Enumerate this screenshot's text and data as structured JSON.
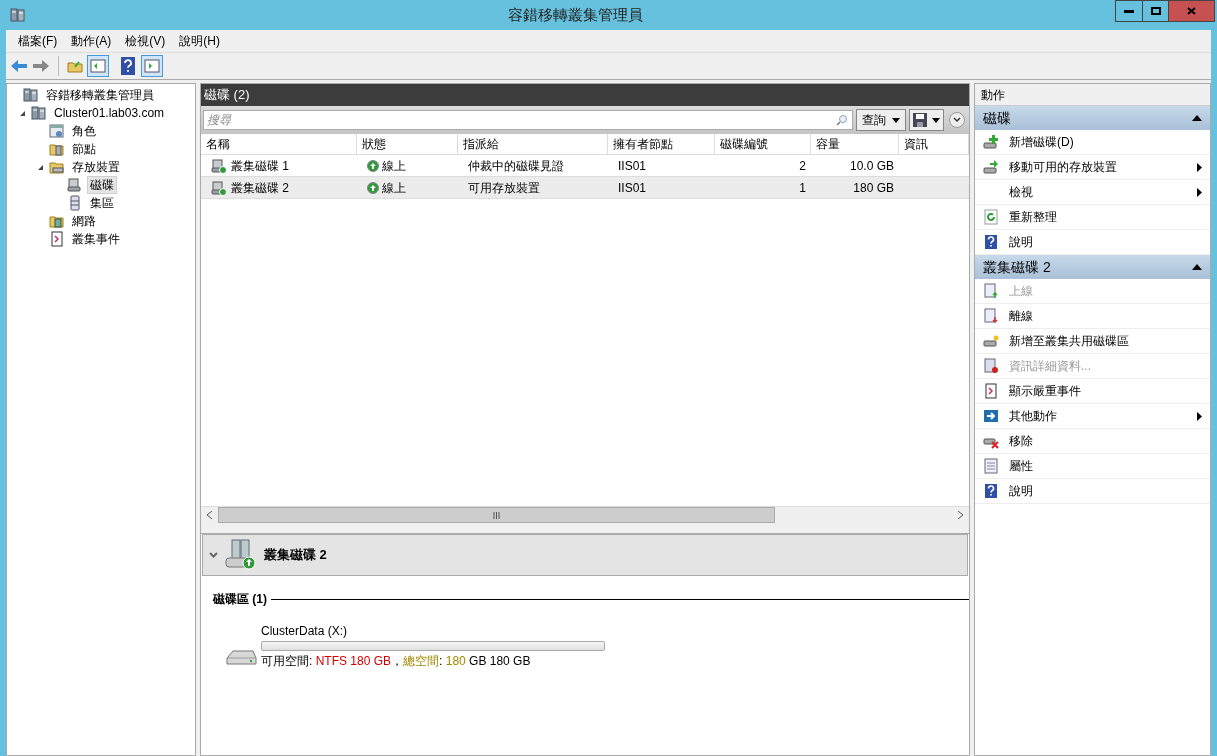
{
  "window": {
    "title": "容錯移轉叢集管理員"
  },
  "menu": [
    "檔案(F)",
    "動作(A)",
    "檢視(V)",
    "說明(H)"
  ],
  "tree": [
    {
      "label": "容錯移轉叢集管理員",
      "kind": "cluster",
      "selected": false,
      "children": [
        {
          "label": "Cluster01.lab03.com",
          "kind": "cluster",
          "selected": false,
          "expanded": true,
          "children": [
            {
              "label": "角色",
              "kind": "roles",
              "selected": false
            },
            {
              "label": "節點",
              "kind": "nodes",
              "selected": false
            },
            {
              "label": "存放裝置",
              "kind": "storage",
              "selected": false,
              "expanded": true,
              "children": [
                {
                  "label": "磁碟",
                  "kind": "disk",
                  "selected": true
                },
                {
                  "label": "集區",
                  "kind": "pool",
                  "selected": false
                }
              ]
            },
            {
              "label": "網路",
              "kind": "network",
              "selected": false
            },
            {
              "label": "叢集事件",
              "kind": "events",
              "selected": false
            }
          ]
        }
      ]
    }
  ],
  "center": {
    "title": "磁碟 (2)",
    "search": {
      "placeholder": "搜尋"
    },
    "query_button": "查詢",
    "table": {
      "columns": [
        "名稱",
        "狀態",
        "指派給",
        "擁有者節點",
        "磁碟編號",
        "容量",
        "資訊"
      ],
      "rows": [
        {
          "name": "叢集磁碟 1",
          "status": "線上",
          "assigned_to": "仲裁中的磁碟見證",
          "owner_node": "IIS01",
          "disk_number": "2",
          "capacity": "10.0 GB",
          "selected": false
        },
        {
          "name": "叢集磁碟 2",
          "status": "線上",
          "assigned_to": "可用存放裝置",
          "owner_node": "IIS01",
          "disk_number": "1",
          "capacity": "180 GB",
          "selected": true
        }
      ]
    }
  },
  "details": {
    "title": "叢集磁碟 2",
    "expanded": true,
    "section": "磁碟區 (1)",
    "volume": {
      "name": "ClusterData (X:)",
      "info": [
        {
          "text": "可用空間: ",
          "kind": "plain"
        },
        {
          "text": "NTFS 180 GB",
          "kind": "red"
        },
        {
          "text": "，",
          "kind": "plain"
        },
        {
          "text": "總空間",
          "kind": "yellow"
        },
        {
          "text": ": ",
          "kind": "plain"
        },
        {
          "text": "180",
          "kind": "yellow"
        },
        {
          "text": " GB 180 GB",
          "kind": "plain"
        }
      ]
    }
  },
  "actions": {
    "title": "動作",
    "sections": [
      {
        "title": "磁碟",
        "expanded": true,
        "items": [
          {
            "label": "新增磁碟(D)",
            "kind": "add-disk",
            "disabled": false,
            "submenu": false
          },
          {
            "label": "移動可用的存放裝置",
            "kind": "move-storage",
            "disabled": false,
            "submenu": true
          },
          {
            "label": "檢視",
            "kind": "none",
            "disabled": false,
            "submenu": true
          },
          {
            "label": "重新整理",
            "kind": "refresh",
            "disabled": false,
            "submenu": false
          },
          {
            "label": "說明",
            "kind": "help",
            "disabled": false,
            "submenu": false
          }
        ]
      },
      {
        "title": "叢集磁碟 2",
        "expanded": true,
        "items": [
          {
            "label": "上線",
            "kind": "online",
            "disabled": true,
            "submenu": false
          },
          {
            "label": "離線",
            "kind": "offline",
            "disabled": false,
            "submenu": false
          },
          {
            "label": "新增至叢集共用磁碟區",
            "kind": "add-csv",
            "disabled": false,
            "submenu": false
          },
          {
            "label": "資訊詳細資料...",
            "kind": "info",
            "disabled": true,
            "submenu": false
          },
          {
            "label": "顯示嚴重事件",
            "kind": "events",
            "disabled": false,
            "submenu": false
          },
          {
            "label": "其他動作",
            "kind": "more",
            "disabled": false,
            "submenu": true
          },
          {
            "label": "移除",
            "kind": "remove",
            "disabled": false,
            "submenu": false
          },
          {
            "label": "屬性",
            "kind": "properties",
            "disabled": false,
            "submenu": false
          },
          {
            "label": "說明",
            "kind": "help",
            "disabled": false,
            "submenu": false
          }
        ]
      }
    ]
  }
}
